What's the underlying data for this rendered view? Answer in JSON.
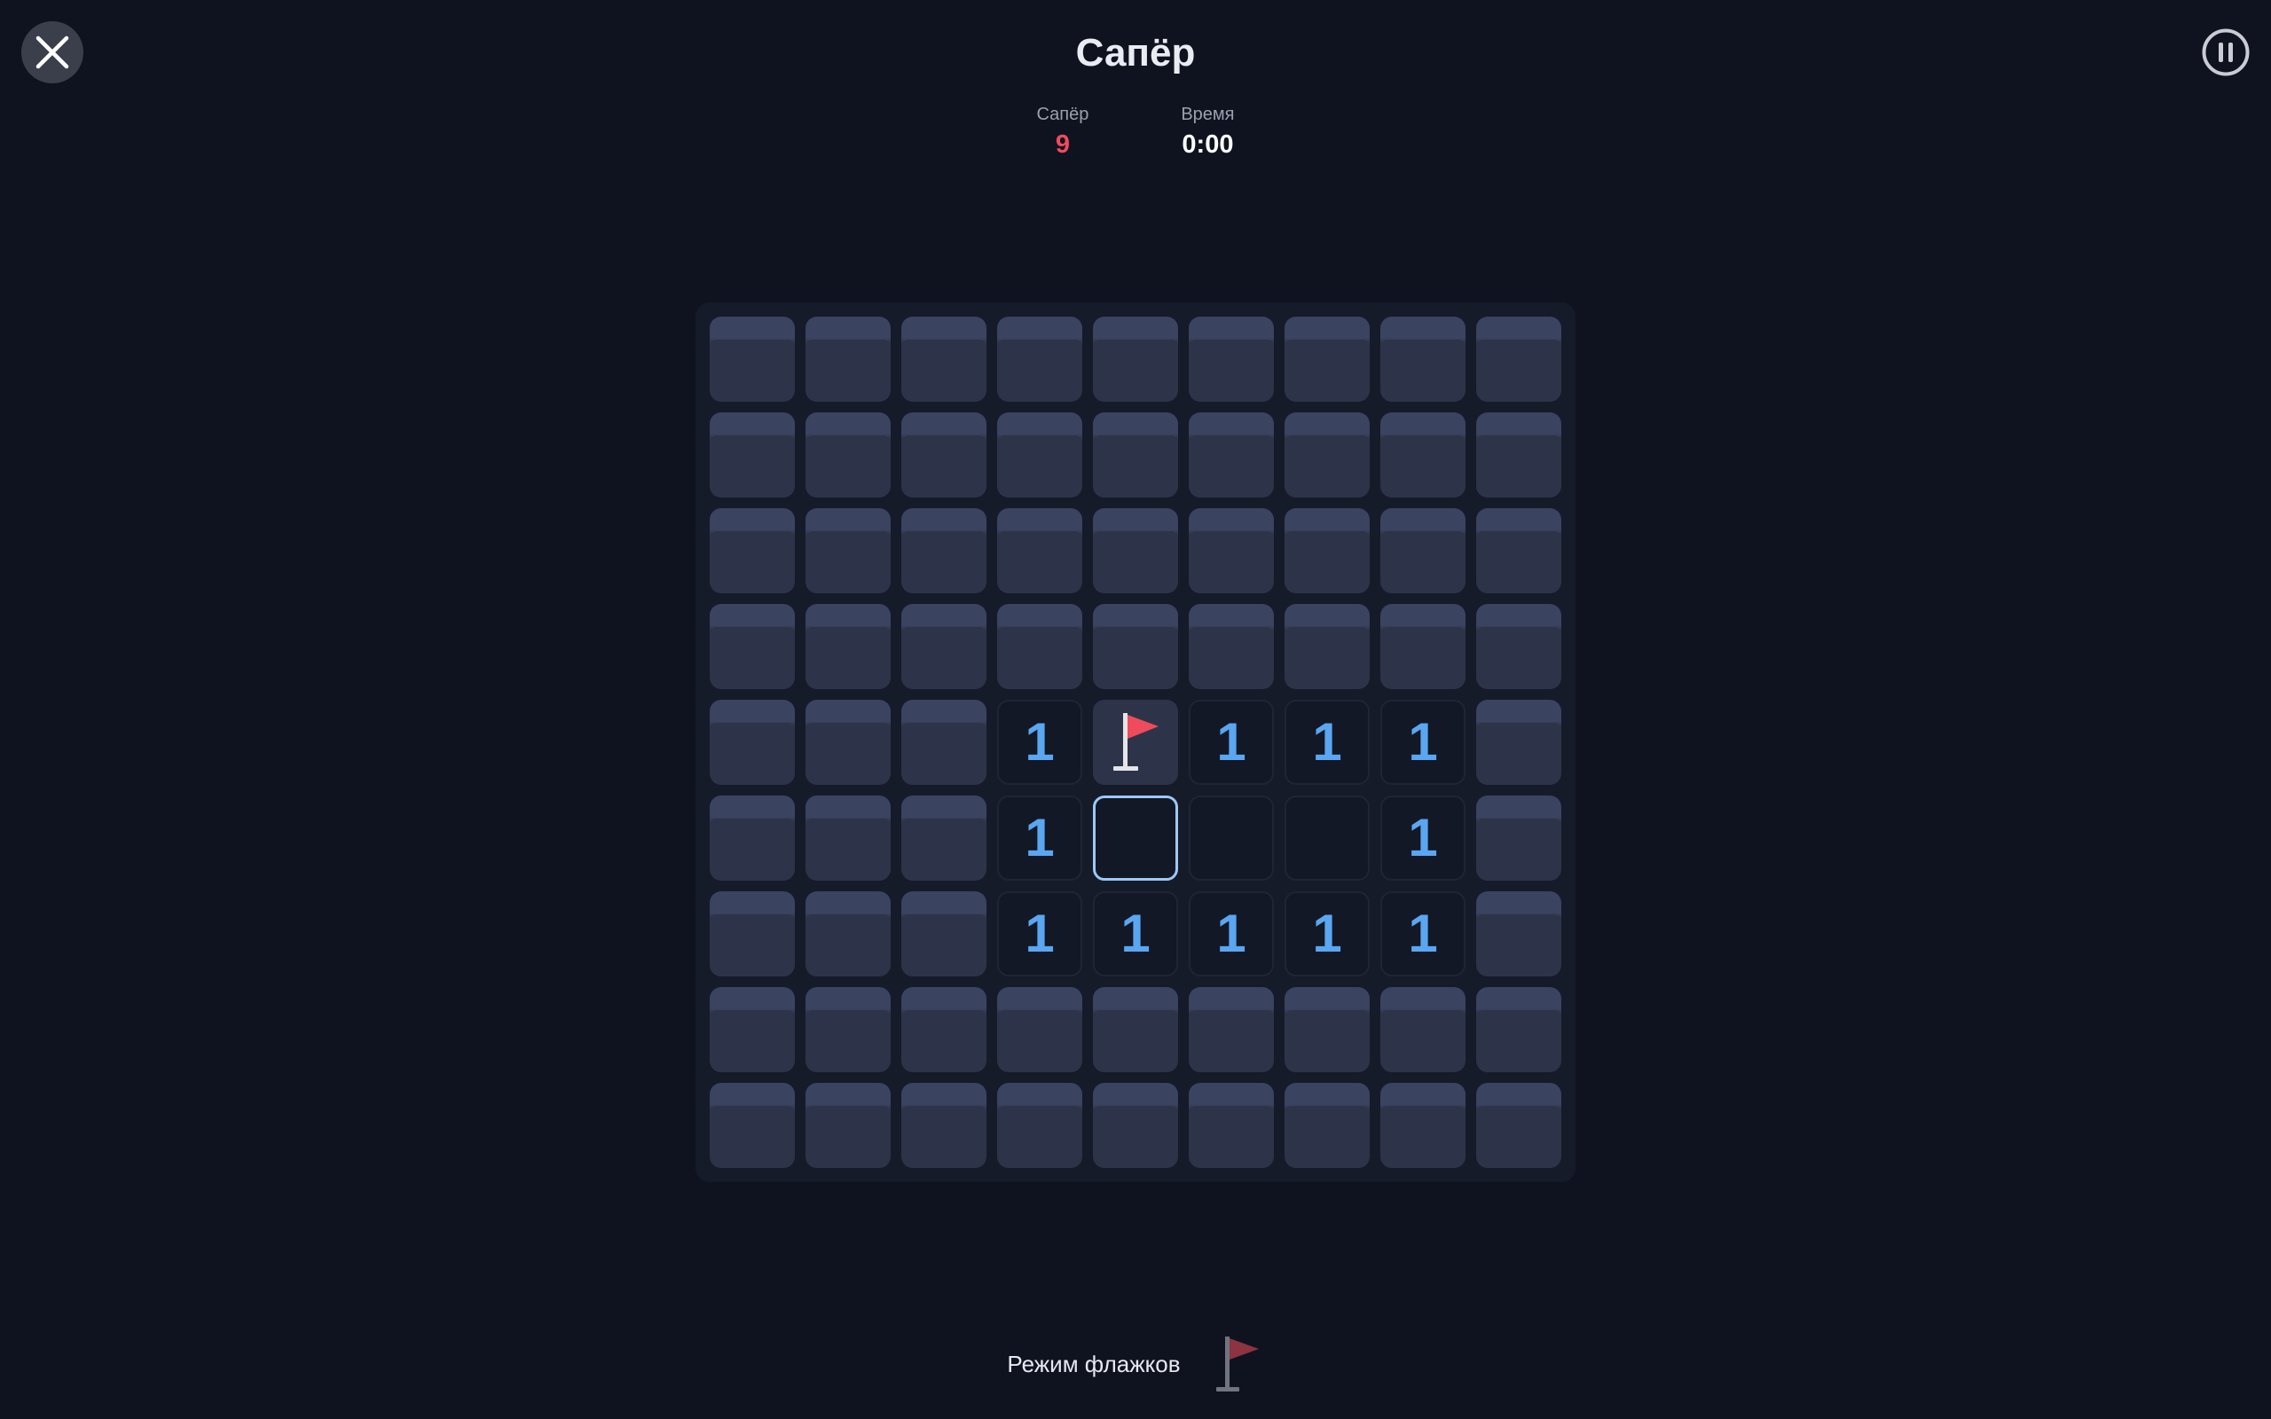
{
  "header": {
    "title": "Сапёр",
    "close_icon": "close-icon",
    "pause_icon": "pause-icon"
  },
  "stats": {
    "mines_label": "Сапёр",
    "mines_value": "9",
    "time_label": "Время",
    "time_value": "0:00"
  },
  "board": {
    "rows": 9,
    "cols": 9,
    "cells": [
      [
        "H",
        "H",
        "H",
        "H",
        "H",
        "H",
        "H",
        "H",
        "H"
      ],
      [
        "H",
        "H",
        "H",
        "H",
        "H",
        "H",
        "H",
        "H",
        "H"
      ],
      [
        "H",
        "H",
        "H",
        "H",
        "H",
        "H",
        "H",
        "H",
        "H"
      ],
      [
        "H",
        "H",
        "H",
        "H",
        "H",
        "H",
        "H",
        "H",
        "H"
      ],
      [
        "H",
        "H",
        "H",
        "1",
        "F",
        "1",
        "1",
        "1",
        "H"
      ],
      [
        "H",
        "H",
        "H",
        "1",
        "S",
        "0",
        "0",
        "1",
        "H"
      ],
      [
        "H",
        "H",
        "H",
        "1",
        "1",
        "1",
        "1",
        "1",
        "H"
      ],
      [
        "H",
        "H",
        "H",
        "H",
        "H",
        "H",
        "H",
        "H",
        "H"
      ],
      [
        "H",
        "H",
        "H",
        "H",
        "H",
        "H",
        "H",
        "H",
        "H"
      ]
    ],
    "legend": {
      "H": "hidden",
      "F": "flagged",
      "S": "selected-empty",
      "0": "revealed-empty"
    }
  },
  "flag_mode": {
    "label": "Режим флажков",
    "icon": "flag-icon",
    "active": false
  },
  "colors": {
    "background": "#0f1320",
    "number": "#5aa6f0",
    "mines_counter": "#ef4b5c",
    "flag": "#ef4b5c",
    "selected_border": "#9cc9f5"
  }
}
